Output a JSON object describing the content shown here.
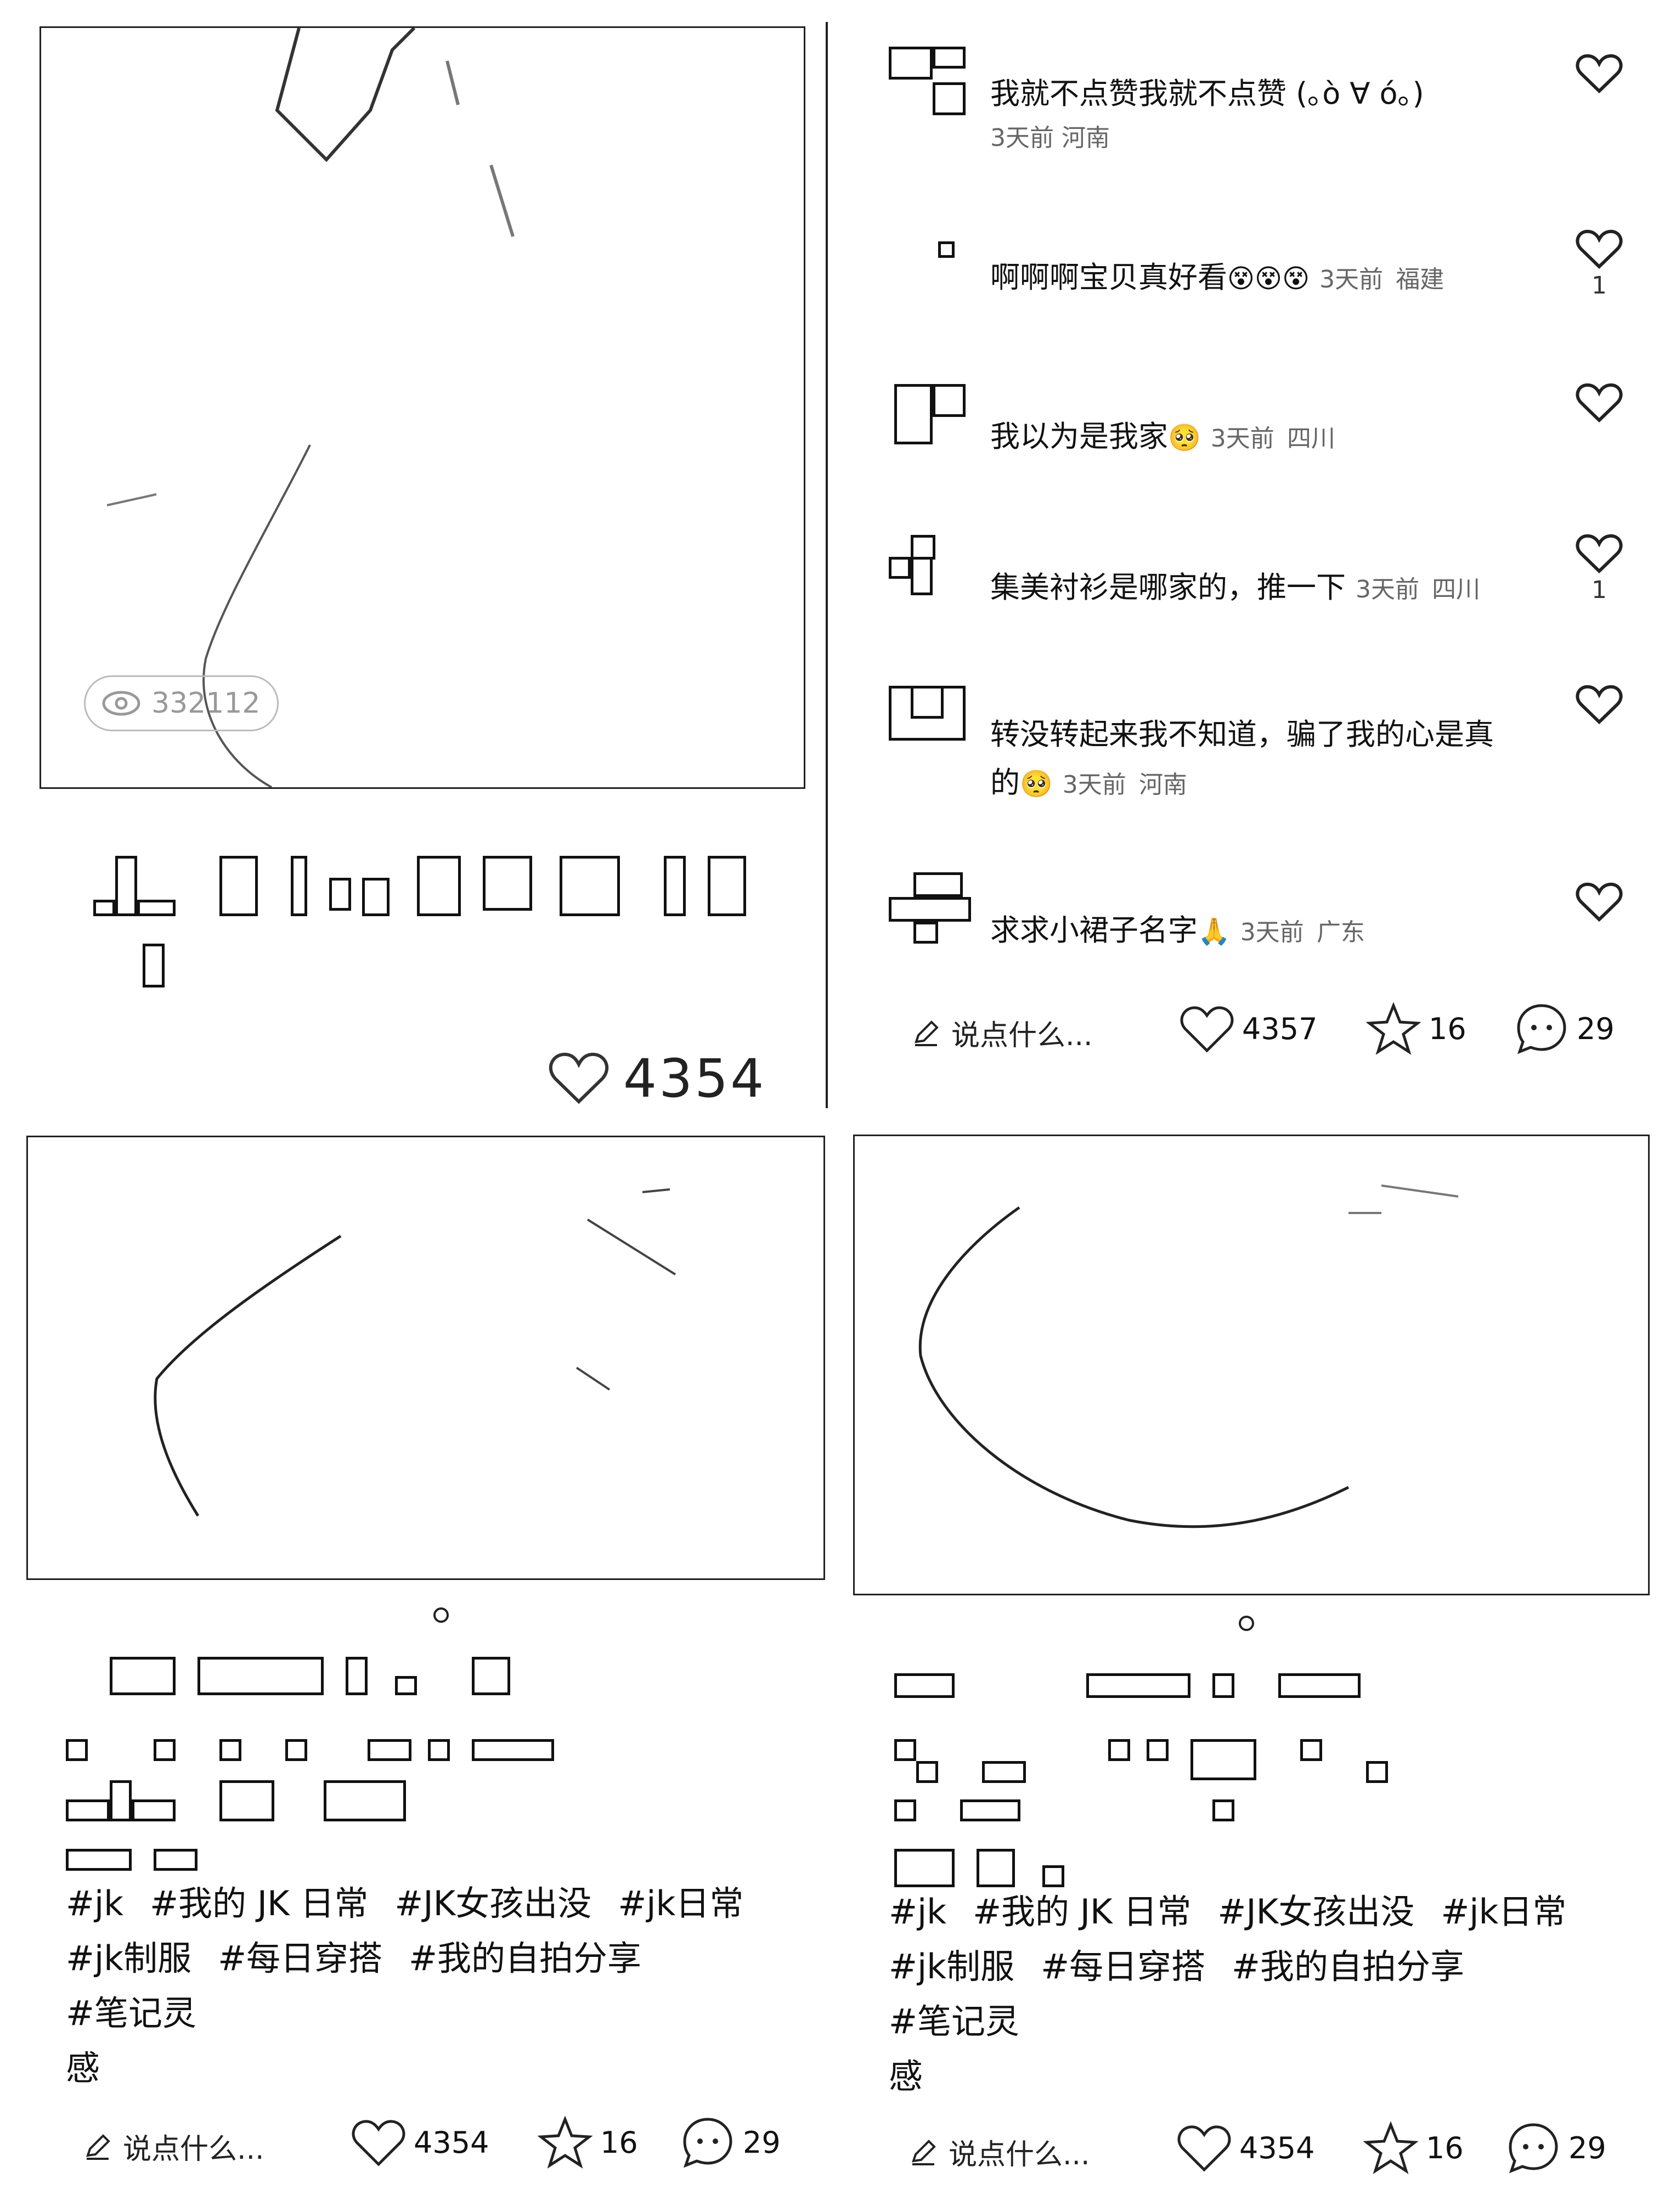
{
  "panel_top_left": {
    "view_count": "332112",
    "like_count": "4354"
  },
  "comments": [
    {
      "text": "我就不点赞我就不点赞 (｡ò ∀ ó｡)",
      "time": "3天前",
      "region": "河南",
      "likes": ""
    },
    {
      "text": "啊啊啊宝贝真好看",
      "emoji": "😵😵😵",
      "time": "3天前",
      "region": "福建",
      "likes": "1"
    },
    {
      "text": "我以为是我家",
      "emoji": "🥺",
      "time": "3天前",
      "region": "四川",
      "likes": ""
    },
    {
      "text": "集美衬衫是哪家的，推一下",
      "time": "3天前",
      "region": "四川",
      "likes": "1"
    },
    {
      "text": "转没转起来我不知道，骗了我的心是真的",
      "emoji": "🥺",
      "time": "3天前",
      "region": "河南",
      "likes": ""
    },
    {
      "text": "求求小裙子名字",
      "emoji": "🙏",
      "time": "3天前",
      "region": "广东",
      "likes": ""
    }
  ],
  "bar_top_right": {
    "say": "说点什么...",
    "likes": "4357",
    "stars": "16",
    "comments": "29"
  },
  "tags": [
    "#jk",
    "#我的 JK 日常",
    "#JK女孩出没",
    "#jk日常",
    "#jk制服",
    "#每日穿搭",
    "#我的自拍分享",
    "#笔记灵",
    "感"
  ],
  "bar_bottom_left": {
    "say": "说点什么...",
    "likes": "4354",
    "stars": "16",
    "comments": "29"
  },
  "bar_bottom_right": {
    "say": "说点什么...",
    "likes": "4354",
    "stars": "16",
    "comments": "29"
  },
  "colors": {
    "text": "#111111",
    "meta": "#666666",
    "border": "#222222"
  }
}
